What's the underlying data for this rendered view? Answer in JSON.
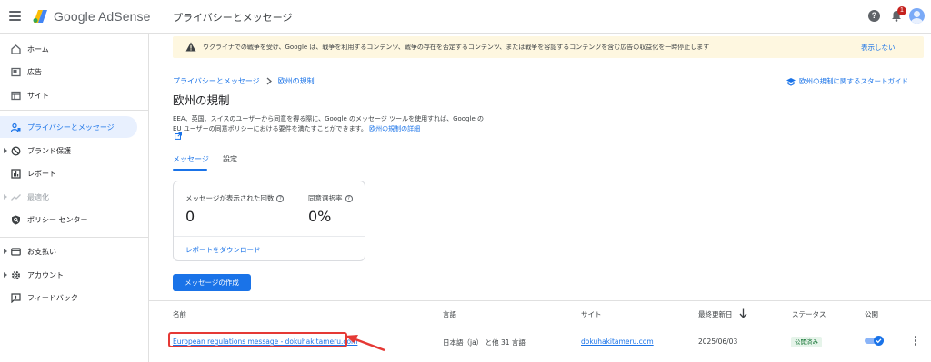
{
  "app": {
    "logo_text": "Google AdSense",
    "page_heading": "プライバシーとメッセージ",
    "notification_count": "1",
    "help_symbol": "?"
  },
  "sidebar": {
    "items": [
      {
        "label": "ホーム",
        "icon": "home-icon"
      },
      {
        "label": "広告",
        "icon": "ads-icon"
      },
      {
        "label": "サイト",
        "icon": "sites-icon"
      },
      {
        "label": "プライバシーとメッセージ",
        "icon": "privacy-icon",
        "active": true
      },
      {
        "label": "ブランド保護",
        "icon": "block-icon"
      },
      {
        "label": "レポート",
        "icon": "reports-icon"
      },
      {
        "label": "最適化",
        "icon": "trending-icon",
        "disabled": true
      },
      {
        "label": "ポリシー センター",
        "icon": "policy-icon"
      },
      {
        "label": "お支払い",
        "icon": "payments-icon"
      },
      {
        "label": "アカウント",
        "icon": "gear-icon"
      },
      {
        "label": "フィードバック",
        "icon": "feedback-icon"
      }
    ]
  },
  "banner": {
    "message": "ウクライナでの戦争を受け、Google は、戦争を利用するコンテンツ、戦争の存在を否定するコンテンツ、または戦争を容認するコンテンツを含む広告の収益化を一時停止します",
    "dismiss_label": "表示しない"
  },
  "breadcrumb": {
    "parent": "プライバシーとメッセージ",
    "current": "欧州の規制"
  },
  "guide_link": "欧州の規制に関するスタートガイド",
  "title": "欧州の規制",
  "description": {
    "text": "EEA、英国、スイスのユーザーから同意を得る際に、Google のメッセージ ツールを使用すれば、Google の EU ユーザーの同意ポリシーにおける要件を満たすことができます。",
    "link": "欧州の規制の詳細"
  },
  "tabs": [
    {
      "label": "メッセージ",
      "active": true
    },
    {
      "label": "設定",
      "active": false
    }
  ],
  "stats": {
    "shown_label": "メッセージが表示された回数",
    "shown_value": "0",
    "consent_label": "同意選択率",
    "consent_value": "0%",
    "download_label": "レポートをダウンロード"
  },
  "create_button": "メッセージの作成",
  "table": {
    "headers": {
      "name": "名前",
      "language": "言語",
      "site": "サイト",
      "updated": "最終更新日",
      "status": "ステータス",
      "published": "公開"
    },
    "rows": [
      {
        "name": "European regulations message - dokuhakitameru.com",
        "language": "日本語（ja） と他 31 言語",
        "site": "dokuhakitameru.com",
        "updated": "2025/06/03",
        "status": "公開済み",
        "published": true
      }
    ]
  },
  "colors": {
    "accent": "#1a73e8",
    "banner_bg": "#fef7e0",
    "highlight": "#e53935",
    "status_bg": "#e6f4ea",
    "status_text": "#137333"
  }
}
